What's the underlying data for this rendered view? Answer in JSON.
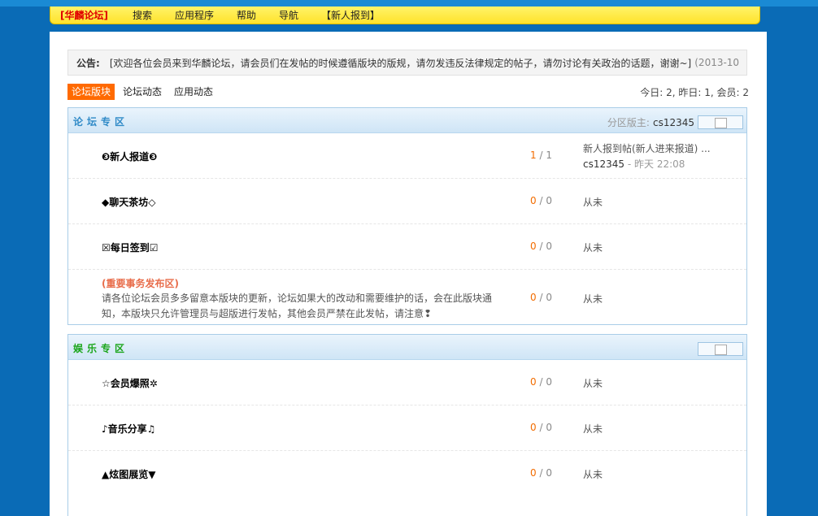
{
  "nav": {
    "brand": "[华麟论坛]",
    "items": [
      "搜索",
      "应用程序",
      "帮助",
      "导航",
      "【新人报到】"
    ]
  },
  "notice": {
    "label": "公告:",
    "text": "[欢迎各位会员来到华麟论坛，请会员们在发帖的时候遵循版块的版规，请勿发违反法律规定的帖子，请勿讨论有关政治的话题，谢谢~]",
    "date": "(2013-10"
  },
  "tabs": [
    "论坛版块",
    "论坛动态",
    "应用动态"
  ],
  "stats": "今日: 2, 昨日: 1, 会员: 2",
  "sections": [
    {
      "title": "论坛专区",
      "title_color": "#2f8ac7",
      "moderator_label": "分区版主:",
      "moderator": "cs12345",
      "forums": [
        {
          "name": "❸新人报道❸",
          "topics": "1",
          "posts": "1",
          "last_title": "新人报到帖(新人进来报道) ...",
          "last_user": "cs12345",
          "last_time": "- 昨天 22:08"
        },
        {
          "name": "◆聊天茶坊◇",
          "topics": "0",
          "posts": "0",
          "last": "从未"
        },
        {
          "name": "☒每日签到☑",
          "topics": "0",
          "posts": "0",
          "last": "从未"
        },
        {
          "name": "(重要事务发布区)",
          "desc": "请各位论坛会员多多留意本版块的更新，论坛如果大的改动和需要维护的话，会在此版块通知，本版块只允许管理员与超版进行发帖，其他会员严禁在此发帖，请注意❢",
          "topics": "0",
          "posts": "0",
          "last": "从未"
        }
      ]
    },
    {
      "title": "娱乐专区",
      "title_color": "#1aa51a",
      "forums": [
        {
          "name": "☆会员爆照✲",
          "topics": "0",
          "posts": "0",
          "last": "从未"
        },
        {
          "name": "♪音乐分享♫",
          "topics": "0",
          "posts": "0",
          "last": "从未"
        },
        {
          "name": "▲炫图展览▼",
          "topics": "0",
          "posts": "0",
          "last": "从未"
        }
      ]
    }
  ],
  "count_separator": " / "
}
